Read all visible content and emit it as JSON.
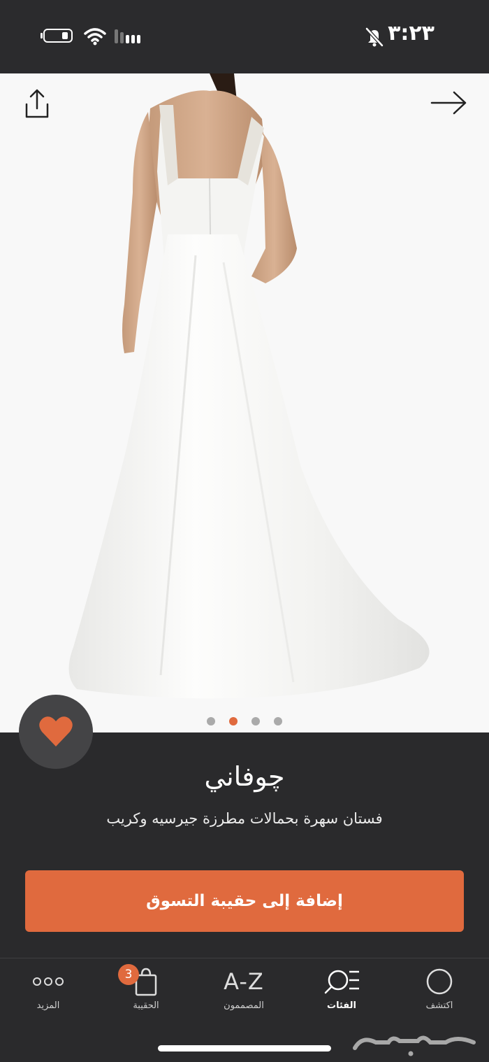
{
  "status_bar": {
    "time": "٣:٢٣",
    "icons": [
      "battery-icon",
      "wifi-icon",
      "signal-icon",
      "mute-icon"
    ]
  },
  "product": {
    "brand": "چوفاني",
    "description": "فستان سهرة بحمالات مطرزة جيرسيه وكريب",
    "image_count": 4,
    "active_image_index": 2,
    "favorited": true
  },
  "actions": {
    "add_to_bag": "إضافة إلى حقيبة التسوق"
  },
  "tab_bar": {
    "items": [
      {
        "label": "اكتشف",
        "icon": "circle-icon"
      },
      {
        "label": "الفئات",
        "icon": "search-list-icon",
        "active": true
      },
      {
        "label": "المصممون",
        "icon": "az-icon",
        "icon_text": "A-Z"
      },
      {
        "label": "الحقيبة",
        "icon": "bag-icon"
      },
      {
        "label": "المزيد",
        "icon": "more-icon"
      }
    ],
    "bag_count": "3"
  },
  "colors": {
    "accent": "#e06a3e",
    "background": "#2a2a2c",
    "image_bg": "#f8f8f8"
  }
}
